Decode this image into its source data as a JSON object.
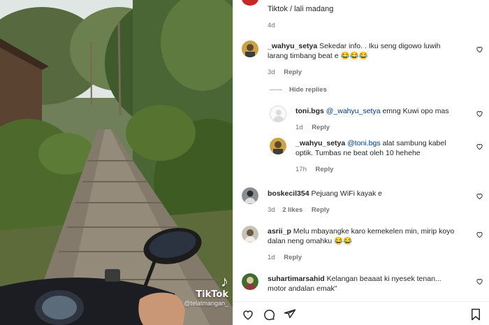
{
  "media": {
    "watermark_logo": "♪",
    "watermark_brand": "TikTok",
    "watermark_handle": "@telatmangan_"
  },
  "caption": {
    "text": "Tiktok / lali madang",
    "time": "4d"
  },
  "comments": [
    {
      "user": "_wahyu_setya",
      "text": "Sekedar info. . Iku seng digowo luwih larang timbang beat e 😂😂😂",
      "time": "3d",
      "reply_label": "Reply"
    },
    {
      "user": "toni.bgs",
      "mention": "@_wahyu_setya",
      "text": "emng Kuwi opo mas",
      "time": "1d",
      "reply_label": "Reply"
    },
    {
      "user": "_wahyu_setya",
      "mention": "@toni.bgs",
      "text": "alat sambung kabel optik. Tumbas ne beat oleh 10 hehehe",
      "time": "17h",
      "reply_label": "Reply"
    },
    {
      "user": "boskecil354",
      "text": "Pejuang WiFi kayak e",
      "time": "3d",
      "likes": "2 likes",
      "reply_label": "Reply"
    },
    {
      "user": "asrii_p",
      "text": "Melu mbayangke karo kemekelen min, mirip koyo dalan neng omahku 😂😂",
      "time": "1d",
      "reply_label": "Reply"
    },
    {
      "user": "suhartimarsahid",
      "text": "Kelangan beaaat ki nyesek tenan... motor andalan emak\""
    }
  ],
  "hide_replies_label": "Hide replies",
  "colors": {
    "text": "#262626",
    "muted": "#737373",
    "mention": "#00376b",
    "divider": "#efefef"
  },
  "icons": [
    "heart-icon",
    "comment-icon",
    "share-icon",
    "bookmark-icon",
    "tiktok-logo-icon"
  ]
}
